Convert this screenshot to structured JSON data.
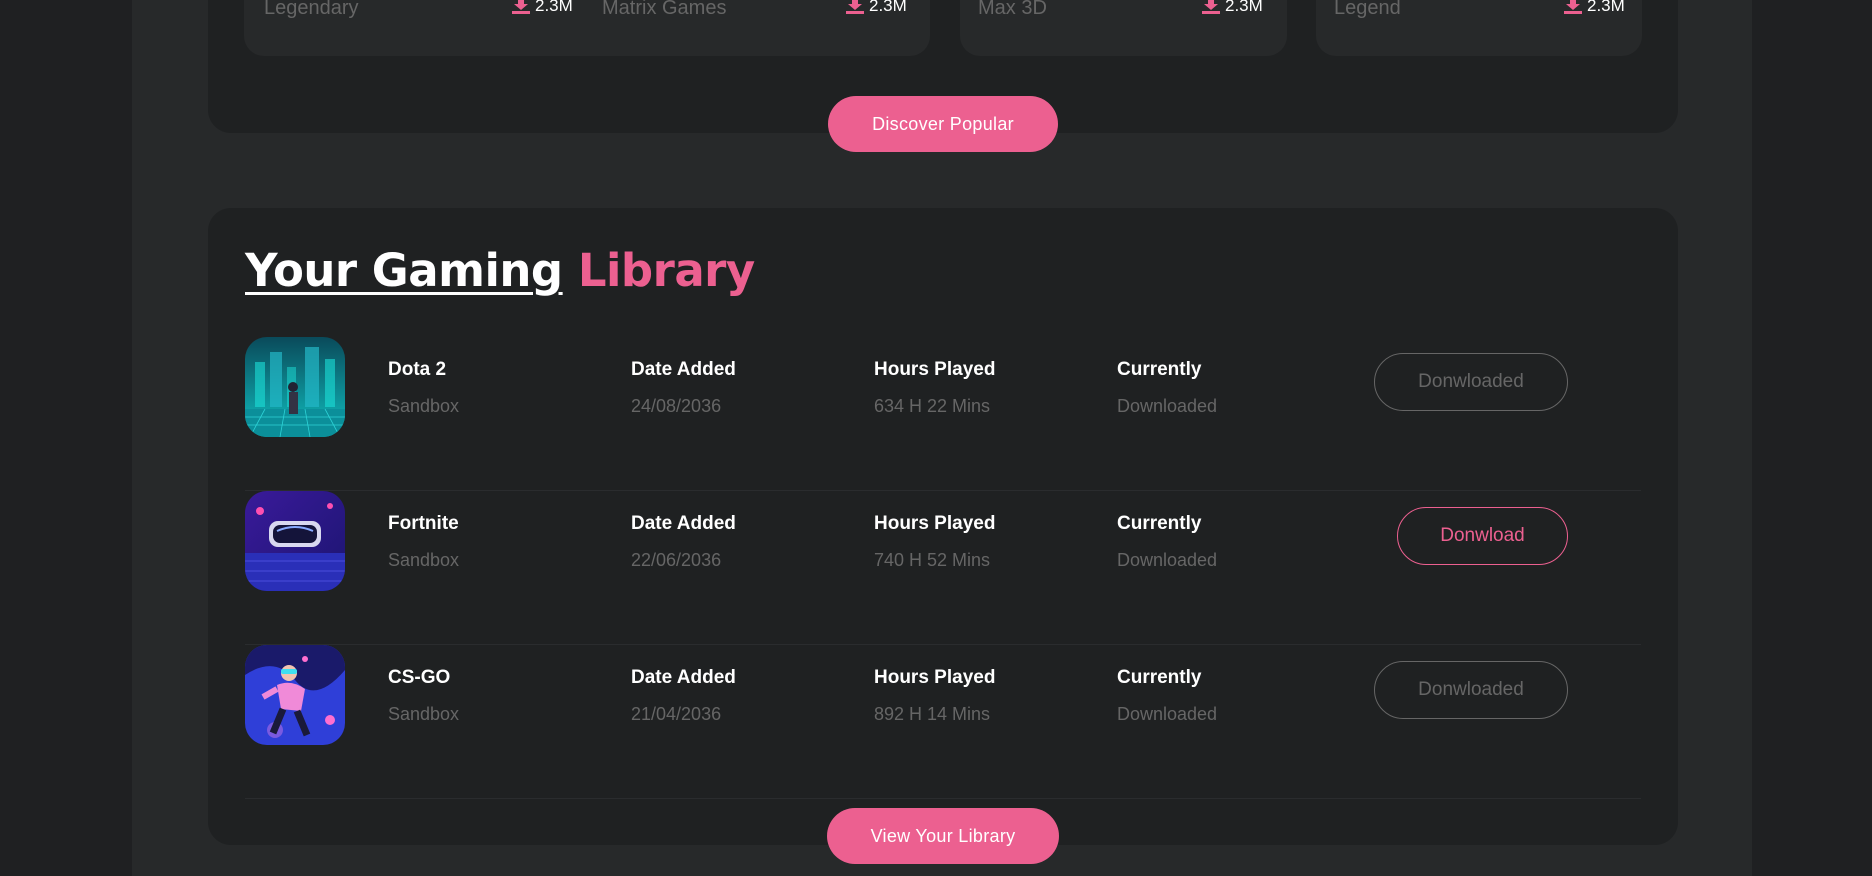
{
  "popular": {
    "items": [
      {
        "sub": "Legendary",
        "downloads": "2.3M"
      },
      {
        "sub": "Matrix Games",
        "downloads": "2.3M"
      },
      {
        "sub": "Max 3D",
        "downloads": "2.3M"
      },
      {
        "sub": "Legend",
        "downloads": "2.3M"
      }
    ],
    "button": "Discover Popular"
  },
  "library": {
    "title_part1": "Your Gaming",
    "title_part2": "Library",
    "rows": [
      {
        "name": "Dota 2",
        "genre": "Sandbox",
        "date_label": "Date Added",
        "date": "24/08/2036",
        "hours_label": "Hours Played",
        "hours": "634 H 22 Mins",
        "status_label": "Currently",
        "status": "Downloaded",
        "button": "Donwloaded"
      },
      {
        "name": "Fortnite",
        "genre": "Sandbox",
        "date_label": "Date Added",
        "date": "22/06/2036",
        "hours_label": "Hours Played",
        "hours": "740 H 52 Mins",
        "status_label": "Currently",
        "status": "Downloaded",
        "button": "Donwload"
      },
      {
        "name": "CS-GO",
        "genre": "Sandbox",
        "date_label": "Date Added",
        "date": "21/04/2036",
        "hours_label": "Hours Played",
        "hours": "892 H 14 Mins",
        "status_label": "Currently",
        "status": "Downloaded",
        "button": "Donwloaded"
      }
    ],
    "button": "View Your Library"
  },
  "colors": {
    "accent": "#ec6090",
    "page": "#27292a",
    "card": "#1f2122",
    "muted": "#666666"
  },
  "icons": [
    "download-icon",
    "game-thumbnail"
  ]
}
